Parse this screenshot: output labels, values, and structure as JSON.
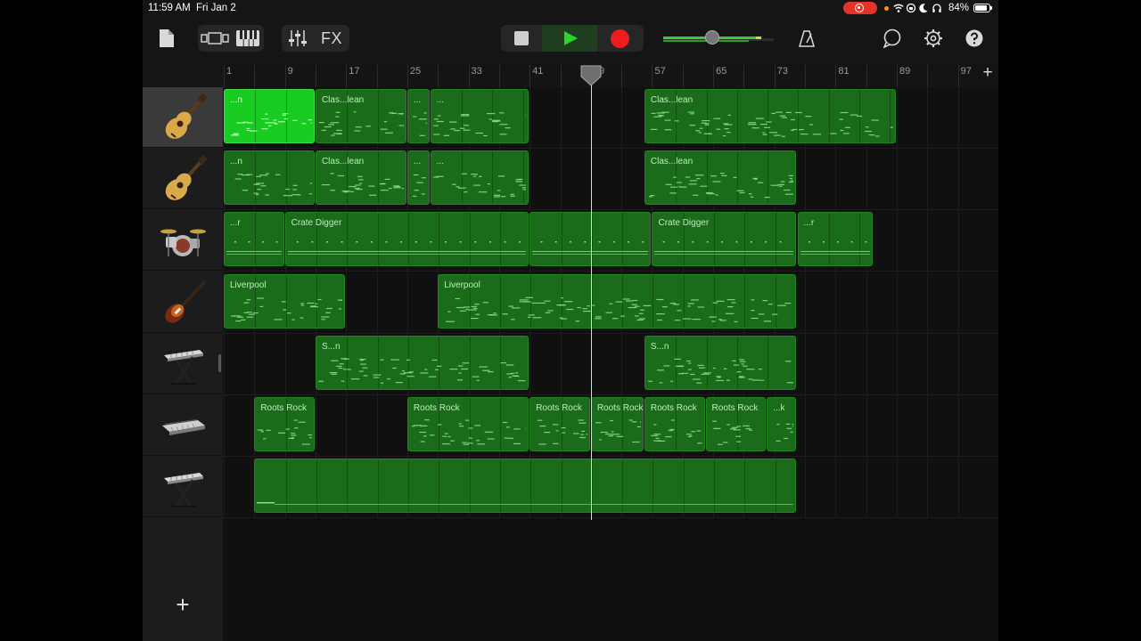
{
  "status_bar": {
    "time": "11:59 AM",
    "date": "Fri Jan 2",
    "battery_text": "84%",
    "battery_level": 0.84
  },
  "toolbar": {
    "fx_label": "FX",
    "icons": [
      "document-icon",
      "tracks-view-icon",
      "keyboard-icon",
      "mixer-icon",
      "stop-icon",
      "play-icon",
      "record-icon",
      "metronome-icon",
      "loop-icon",
      "settings-icon",
      "help-icon"
    ],
    "master_volume": 0.38
  },
  "colors": {
    "region": "#1a6b1a",
    "region_selected": "#18cc22",
    "play_active_bg": "#1f3d1f",
    "record": "#ee1c1c"
  },
  "ruler": {
    "bar_labels": [
      "1",
      "9",
      "17",
      "25",
      "33",
      "41",
      "49",
      "57",
      "65",
      "73",
      "81",
      "89",
      "97"
    ]
  },
  "playhead": {
    "bar": 49
  },
  "tracks": [
    {
      "instrument": "acoustic-guitar-icon",
      "selected": true,
      "regions": [
        {
          "start": 1,
          "end": 13,
          "name": "...n",
          "bright": true
        },
        {
          "start": 13,
          "end": 25,
          "name": "Clas...lean"
        },
        {
          "start": 25,
          "end": 28,
          "name": "..."
        },
        {
          "start": 28,
          "end": 41,
          "name": "..."
        },
        {
          "start": 56,
          "end": 89,
          "name": "Clas...lean"
        }
      ]
    },
    {
      "instrument": "acoustic-guitar-icon",
      "selected": false,
      "regions": [
        {
          "start": 1,
          "end": 13,
          "name": "...n"
        },
        {
          "start": 13,
          "end": 25,
          "name": "Clas...lean"
        },
        {
          "start": 25,
          "end": 28,
          "name": "..."
        },
        {
          "start": 28,
          "end": 41,
          "name": "..."
        },
        {
          "start": 56,
          "end": 76,
          "name": "Clas...lean"
        }
      ]
    },
    {
      "instrument": "drum-kit-icon",
      "selected": false,
      "regions": [
        {
          "start": 1,
          "end": 9,
          "name": "...r"
        },
        {
          "start": 9,
          "end": 41,
          "name": "Crate Digger"
        },
        {
          "start": 41,
          "end": 57,
          "name": ""
        },
        {
          "start": 57,
          "end": 76,
          "name": "Crate Digger"
        },
        {
          "start": 76,
          "end": 86,
          "name": "...r"
        }
      ]
    },
    {
      "instrument": "bass-guitar-icon",
      "selected": false,
      "regions": [
        {
          "start": 1,
          "end": 17,
          "name": "Liverpool"
        },
        {
          "start": 29,
          "end": 76,
          "name": "Liverpool"
        }
      ]
    },
    {
      "instrument": "keyboard-stand-icon",
      "selected": false,
      "regions": [
        {
          "start": 13,
          "end": 41,
          "name": "S...n"
        },
        {
          "start": 56,
          "end": 76,
          "name": "S...n"
        }
      ]
    },
    {
      "instrument": "synth-keyboard-icon",
      "selected": false,
      "regions": [
        {
          "start": 5,
          "end": 13,
          "name": "Roots Rock"
        },
        {
          "start": 25,
          "end": 41,
          "name": "Roots Rock"
        },
        {
          "start": 41,
          "end": 49,
          "name": "Roots Rock"
        },
        {
          "start": 49,
          "end": 56,
          "name": "Roots Rock"
        },
        {
          "start": 56,
          "end": 64,
          "name": "Roots Rock"
        },
        {
          "start": 64,
          "end": 72,
          "name": "Roots Rock"
        },
        {
          "start": 72,
          "end": 76,
          "name": "...k"
        }
      ]
    },
    {
      "instrument": "keyboard-stand-icon",
      "selected": false,
      "regions": [
        {
          "start": 5,
          "end": 76,
          "name": ""
        }
      ]
    }
  ]
}
